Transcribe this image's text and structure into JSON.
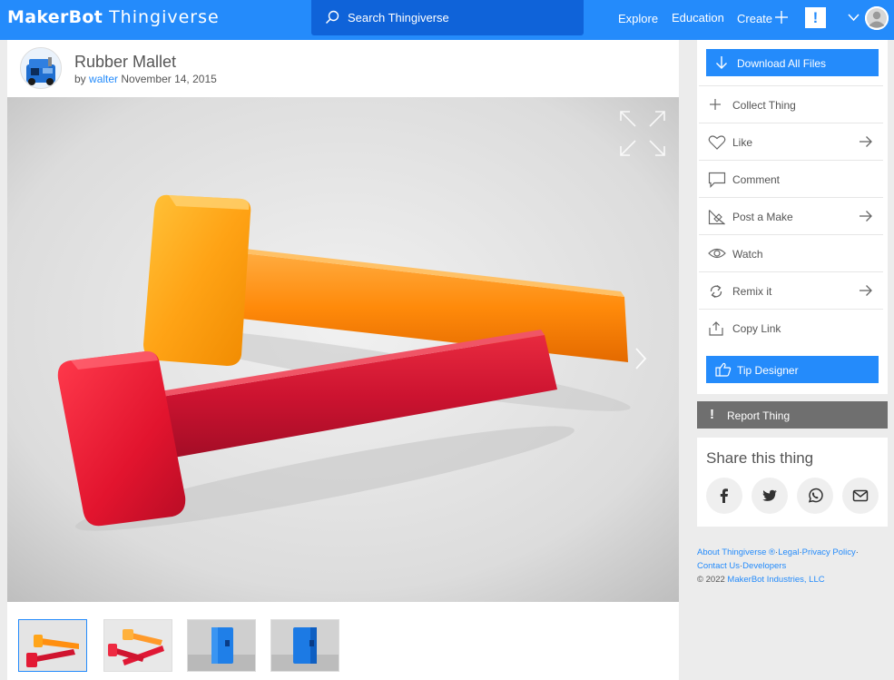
{
  "header": {
    "logo_left": "MakerBot",
    "logo_right": "Thingiverse",
    "search_placeholder": "Search Thingiverse",
    "nav": {
      "explore": "Explore",
      "education": "Education",
      "create": "Create"
    },
    "alert_label": "!"
  },
  "thing": {
    "title": "Rubber Mallet",
    "by": "by",
    "author": "walter",
    "date": "November 14, 2015"
  },
  "actions": {
    "download": "Download All Files",
    "collect": "Collect Thing",
    "like": "Like",
    "comment": "Comment",
    "post_make": "Post a Make",
    "watch": "Watch",
    "remix": "Remix it",
    "copy_link": "Copy Link",
    "tip": "Tip Designer"
  },
  "report": {
    "bang": "!",
    "label": "Report Thing"
  },
  "share": {
    "title": "Share this thing"
  },
  "footer": {
    "about": "About Thingiverse ®",
    "sep": "·",
    "legal": "Legal",
    "privacy": "Privacy Policy",
    "contact": "Contact Us",
    "developers": "Developers",
    "copyright_prefix": "©  2022 ",
    "company": "MakerBot Industries, LLC"
  },
  "colors": {
    "brand_blue": "#248bfb",
    "search_bg": "#0f63d9",
    "report_gray": "#6f6f6f"
  }
}
